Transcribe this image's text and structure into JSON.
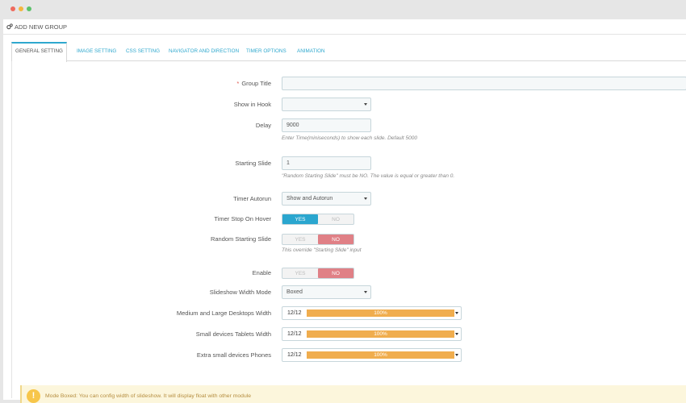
{
  "window": {
    "controls": [
      "close",
      "minimize",
      "maximize"
    ]
  },
  "header": {
    "icon": "gears-icon",
    "title": "ADD NEW GROUP"
  },
  "tabs": [
    {
      "label": "GENERAL SETTING",
      "active": true
    },
    {
      "label": "IMAGE SETTING",
      "active": false
    },
    {
      "label": "CSS SETTING",
      "active": false
    },
    {
      "label": "NAVIGATOR AND DIRECTION",
      "active": false
    },
    {
      "label": "TIMER OPTIONS",
      "active": false
    },
    {
      "label": "ANIMATION",
      "active": false
    }
  ],
  "form": {
    "group_title": {
      "label": "Group Title",
      "required_mark": "*",
      "value": ""
    },
    "show_in_hook": {
      "label": "Show in Hook",
      "value": ""
    },
    "delay": {
      "label": "Delay",
      "value": "9000",
      "help": "Enter Time(miniseconds) to show each slide. Default 5000"
    },
    "starting_slide": {
      "label": "Starting Slide",
      "value": "1",
      "help": "\"Random Starting Slide\" must be NO. The value is equal or greater than 0."
    },
    "timer_autorun": {
      "label": "Timer Autorun",
      "value": "Show and Autorun"
    },
    "timer_stop_on_hover": {
      "label": "Timer Stop On Hover",
      "yes": "YES",
      "no": "NO",
      "selected": "YES"
    },
    "random_starting_slide": {
      "label": "Random Starting Slide",
      "yes": "YES",
      "no": "NO",
      "selected": "NO",
      "help": "This override \"Starting Slide\" input"
    },
    "enable": {
      "label": "Enable",
      "yes": "YES",
      "no": "NO",
      "selected": "NO"
    },
    "slideshow_width_mode": {
      "label": "Slideshow Width Mode",
      "value": "Boxed"
    },
    "md_lg_width": {
      "label": "Medium and Large Desktops Width",
      "value": "12/12",
      "percent_label": "100%",
      "fill_fraction": 1.0
    },
    "sm_width": {
      "label": "Small devices Tablets Width",
      "value": "12/12",
      "percent_label": "100%",
      "fill_fraction": 1.0
    },
    "xs_width": {
      "label": "Extra small devices Phones",
      "value": "12/12",
      "percent_label": "100%",
      "fill_fraction": 1.0
    }
  },
  "alert": {
    "icon": "exclamation-icon",
    "icon_glyph": "!",
    "text": "Mode Boxed: You can config width of slideshow. It will display float with other module"
  },
  "colors": {
    "accent": "#2aa6cf",
    "no_active": "#e08086",
    "width_bar": "#f0ad4e",
    "alert_bg": "#fcf6dc"
  }
}
